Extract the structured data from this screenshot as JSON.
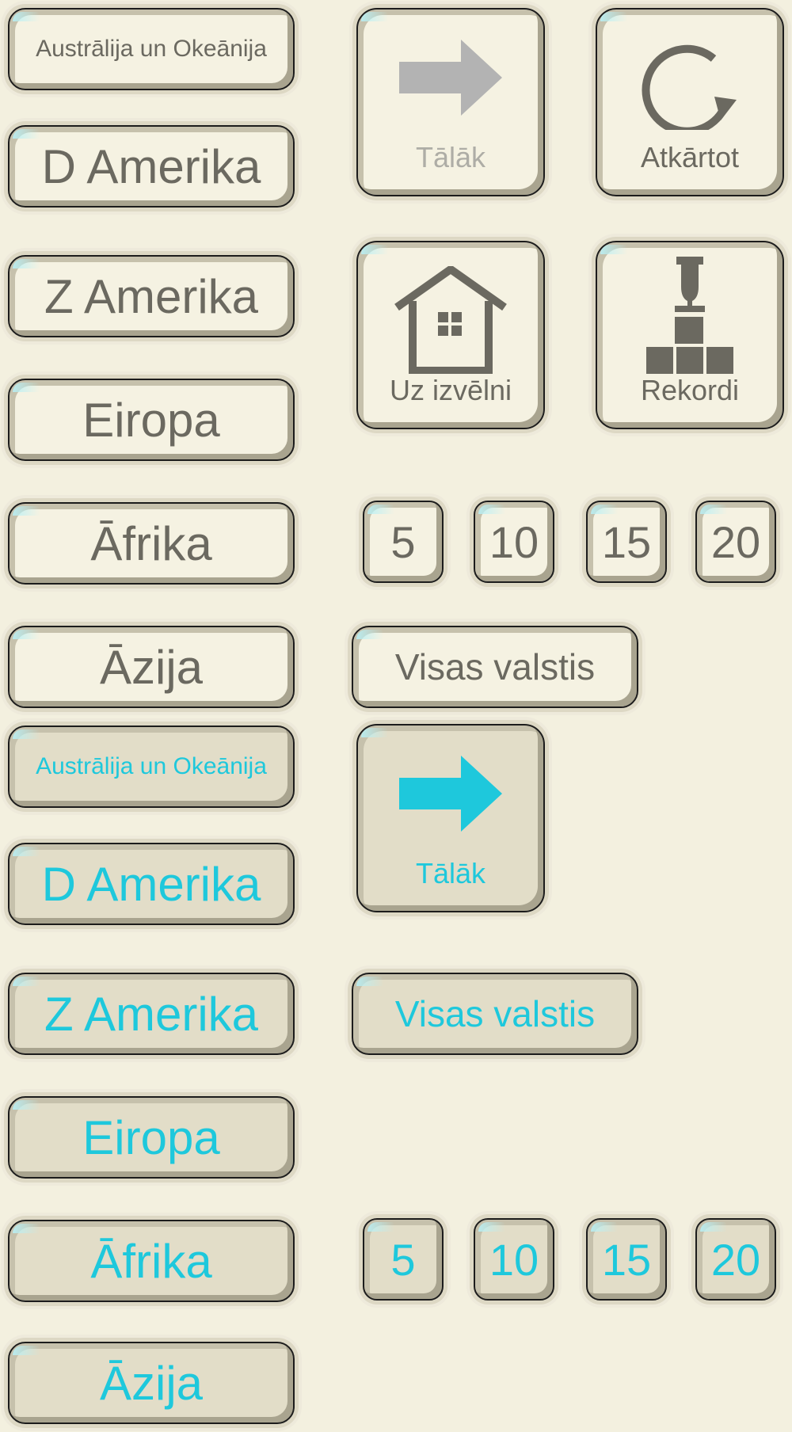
{
  "regions": {
    "australia": "Austrālija un Okeānija",
    "south_america": "D Amerika",
    "north_america": "Z Amerika",
    "europe": "Eiropa",
    "africa": "Āfrika",
    "asia": "Āzija"
  },
  "actions": {
    "next": "Tālāk",
    "retry": "Atkārtot",
    "menu": "Uz izvēlni",
    "records": "Rekordi",
    "all_countries": "Visas valstis"
  },
  "counts": [
    "5",
    "10",
    "15",
    "20"
  ],
  "colors": {
    "background": "#f3f0df",
    "text_normal": "#6b6960",
    "text_active": "#1ec8dc",
    "text_disabled": "#aeada6",
    "icon_normal": "#6b6960",
    "icon_disabled": "#b3b3b3",
    "icon_active": "#1ec8dc"
  },
  "icons": {
    "next": "arrow-right-icon",
    "retry": "refresh-icon",
    "menu": "home-icon",
    "records": "trophy-icon"
  }
}
